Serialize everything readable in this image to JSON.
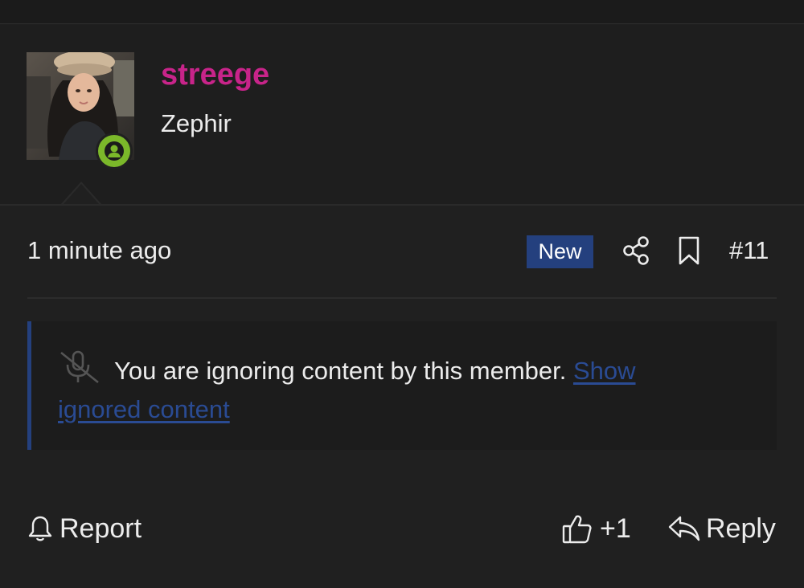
{
  "user": {
    "username": "streege",
    "title": "Zephir",
    "status": "online"
  },
  "post": {
    "timestamp": "1 minute ago",
    "new_badge": "New",
    "number": "#11"
  },
  "ignored": {
    "message": "You are ignoring content by this member.",
    "link_label": "Show ignored content"
  },
  "actions": {
    "report_label": "Report",
    "like_label": "+1",
    "reply_label": "Reply"
  },
  "icons": {
    "share": "share-icon",
    "bookmark": "bookmark-icon",
    "mute": "microphone-off-icon",
    "report": "bell-icon",
    "like": "thumbs-up-icon",
    "reply": "reply-icon"
  },
  "colors": {
    "background": "#202020",
    "username": "#c8248a",
    "accent": "#24407e",
    "link": "#2a4b93",
    "online": "#7bb82a"
  }
}
